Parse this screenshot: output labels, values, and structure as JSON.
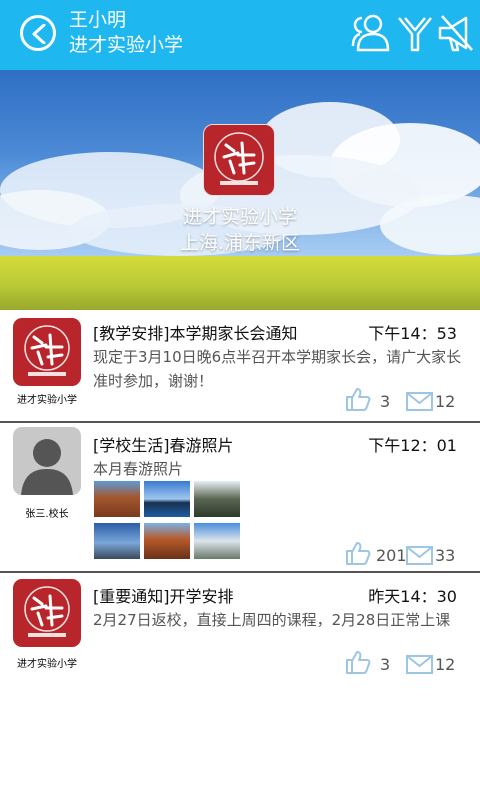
{
  "header": {
    "user_name": "王小明",
    "school_name": "进才实验小学",
    "icons": [
      "back-icon",
      "contacts-icon",
      "signal-icon",
      "broadcast-icon"
    ]
  },
  "banner": {
    "line1": "进才实验小学",
    "line2": "上海.浦东新区"
  },
  "posts": [
    {
      "author": "进才实验小学",
      "title": "[教学安排]本学期家长会通知",
      "time": "下午14：53",
      "body": "现定于3月10日晚6点半召开本学期家长会，请广大家长准时参加，谢谢！",
      "likes": "3",
      "comments": "12"
    },
    {
      "author": "张三.校长",
      "title": "[学校生活]春游照片",
      "time": "下午12：01",
      "body": "本月春游照片",
      "photo_count": 6,
      "likes": "201",
      "comments": "33"
    },
    {
      "author": "进才实验小学",
      "title": "[重要通知]开学安排",
      "time": "昨天14：30",
      "body": "2月27日返校，直接上周四的课程，2月28日正常上课",
      "likes": "3",
      "comments": "12"
    }
  ],
  "colors": {
    "header_bg": "#1fb7f0",
    "logo_red": "#b8252b",
    "icon_blue": "#9cc6e2"
  }
}
